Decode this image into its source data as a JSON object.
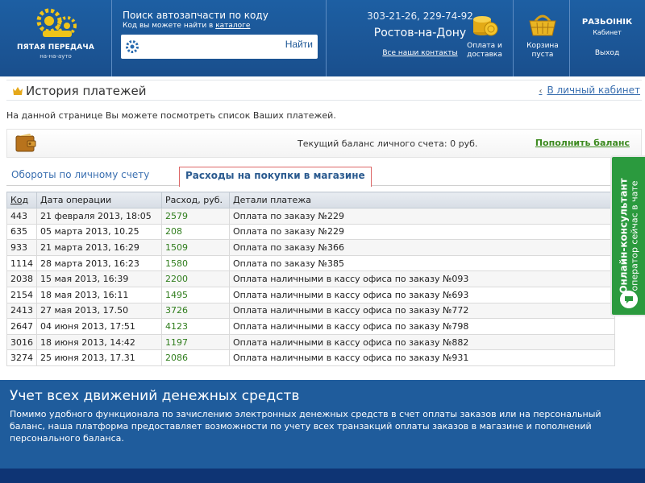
{
  "header": {
    "logo": {
      "name": "ПЯТАЯ ПЕРЕДАЧА",
      "sub": "на-на-ауто"
    },
    "search": {
      "title": "Поиск автозапчасти по коду",
      "sub_prefix": "Код вы можете найти в ",
      "sub_link": "каталоге",
      "placeholder": "",
      "button": "Найти"
    },
    "contacts": {
      "phones": "303-21-26, 229-74-92",
      "city": "Ростов-на-Дону",
      "link": "Все наши контакты"
    },
    "payment": {
      "label_1": "Оплата и",
      "label_2": "доставка"
    },
    "cart": {
      "label_1": "Корзина",
      "label_2": "пуста"
    },
    "user": {
      "name": "РАЗЬОІНІК",
      "cabinet": "Кабинет",
      "logout": "Выход"
    }
  },
  "page": {
    "title": "История платежей",
    "cabinet_link": "В личный кабинет",
    "info": "На данной странице Вы можете посмотреть список Ваших платежей."
  },
  "balance": {
    "text": "Текущий баланс личного счета: 0 руб.",
    "topup": "Пополнить баланс"
  },
  "tabs": [
    {
      "label": "Обороты по личному счету",
      "active": false
    },
    {
      "label": "Расходы на покупки в магазине",
      "active": true
    }
  ],
  "table": {
    "headers": [
      "Код",
      "Дата операции",
      "Расход, руб.",
      "Детали платежа"
    ],
    "rows": [
      [
        "443",
        "21 февраля 2013, 18:05",
        "2579",
        "Оплата по заказу №229"
      ],
      [
        "635",
        "05 марта 2013, 10.25",
        "208",
        "Оплата по заказу №229"
      ],
      [
        "933",
        "21 марта 2013, 16:29",
        "1509",
        "Оплата по заказу №366"
      ],
      [
        "1114",
        "28 марта 2013, 16:23",
        "1580",
        "Оплата по заказу №385"
      ],
      [
        "2038",
        "15 мая 2013, 16:39",
        "2200",
        "Оплата наличными в кассу офиса по заказу №093"
      ],
      [
        "2154",
        "18 мая 2013, 16:11",
        "1495",
        "Оплата наличными в кассу офиса по заказу №693"
      ],
      [
        "2413",
        "27 мая 2013, 17.50",
        "3726",
        "Оплата наличными в кассу офиса по заказу №772"
      ],
      [
        "2647",
        "04 июня 2013, 17:51",
        "4123",
        "Оплата наличными в кассу офиса по заказу №798"
      ],
      [
        "3016",
        "18 июня 2013, 14:42",
        "1197",
        "Оплата наличными в кассу офиса по заказу №882"
      ],
      [
        "3274",
        "25 июня 2013, 17.31",
        "2086",
        "Оплата наличными в кассу офиса по заказу №931"
      ]
    ]
  },
  "chat": {
    "line_1": "Онлайн-консультант",
    "line_2": "оператор сейчас в чате"
  },
  "banner": {
    "title": "Учет всех движений денежных средств",
    "text": "Помимо удобного функционала по зачислению электронных денежных средств в счет оплаты заказов или на персональный баланс, наша платформа предоставляет возможности по учету всех транзакций оплаты заказов в магазине и пополнений персонального баланса."
  },
  "colors": {
    "header_bg": "#1d5fa3",
    "banner_bg": "#1f5c9c",
    "accent_green": "#2f7d1c",
    "chat_green": "#2b9a3e",
    "link_blue": "#3a6fb0"
  },
  "icons": [
    "gear-logo-icon",
    "search-gear-icon",
    "coins-icon",
    "basket-icon",
    "crown-icon",
    "wallet-icon",
    "chat-bubble-icon"
  ]
}
